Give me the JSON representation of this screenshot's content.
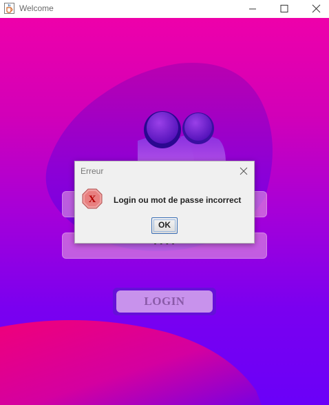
{
  "window": {
    "title": "Welcome",
    "icon": "java-coffee-icon",
    "controls": [
      "minimize-icon",
      "maximize-icon",
      "close-icon"
    ]
  },
  "form": {
    "username_value": "",
    "password_value": "••••",
    "login_label": "LOGIN"
  },
  "decorations": {
    "users_icon": "users-icon"
  },
  "dialog": {
    "title": "Erreur",
    "message": "Login ou mot de passe incorrect",
    "ok_label": "OK",
    "icon": "error-icon"
  },
  "colors": {
    "bg_top": "#ee00aa",
    "bg_bottom": "#6a00f8",
    "login_button": "#c892ec",
    "ok_border": "#3a6eb5",
    "error_red": "#d40000"
  }
}
